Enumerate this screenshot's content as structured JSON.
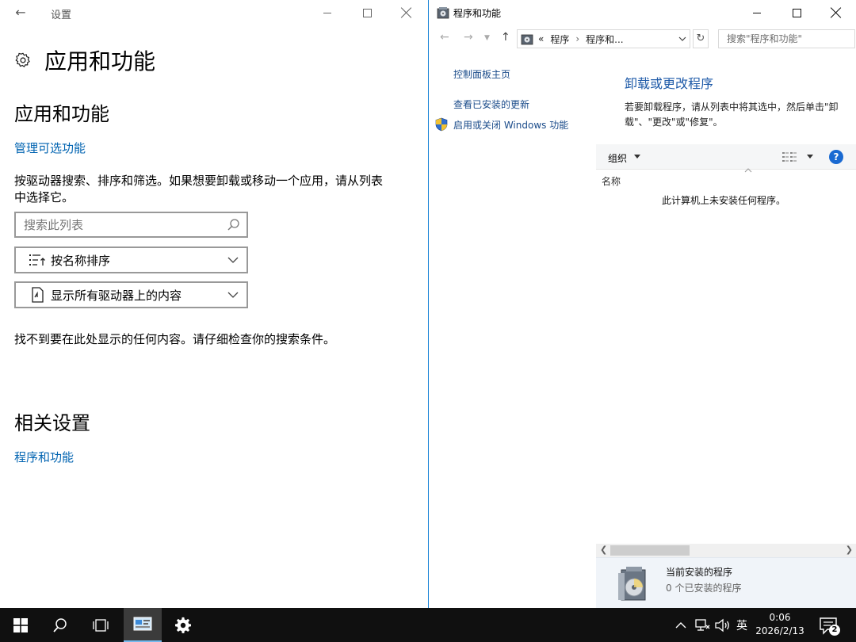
{
  "settings": {
    "window_title": "设置",
    "page_title": "应用和功能",
    "section1_heading": "应用和功能",
    "manage_optional_link": "管理可选功能",
    "description": "按驱动器搜索、排序和筛选。如果想要卸载或移动一个应用，请从列表中选择它。",
    "search_placeholder": "搜索此列表",
    "sort_dropdown": "按名称排序",
    "drive_dropdown": "显示所有驱动器上的内容",
    "empty_message": "找不到要在此处显示的任何内容。请仔细检查你的搜索条件。",
    "related_heading": "相关设置",
    "programs_link": "程序和功能"
  },
  "programs": {
    "window_title": "程序和功能",
    "address": {
      "overflow": "«",
      "crumb1": "程序",
      "crumb2": "程序和..."
    },
    "search_placeholder": "搜索\"程序和功能\"",
    "left_links": {
      "home": "控制面板主页",
      "view_updates": "查看已安装的更新",
      "windows_features": "启用或关闭 Windows 功能"
    },
    "heading": "卸载或更改程序",
    "instructions": "若要卸载程序，请从列表中将其选中，然后单击\"卸载\"、\"更改\"或\"修复\"。",
    "toolbar": {
      "organize": "组织",
      "help": "?"
    },
    "column_name": "名称",
    "empty_list": "此计算机上未安装任何程序。",
    "details": {
      "title": "当前安装的程序",
      "count": "0 个已安装的程序"
    }
  },
  "taskbar": {
    "items": [
      "start-icon",
      "search-icon",
      "task-view-icon",
      "control-panel-icon",
      "settings-gear-icon"
    ],
    "ime": "英",
    "time": "0:06",
    "date": "2026/2/13",
    "notification_count": "2"
  },
  "colors": {
    "link": "#0063b1",
    "accent": "#1883d7",
    "taskbar": "#101010"
  }
}
